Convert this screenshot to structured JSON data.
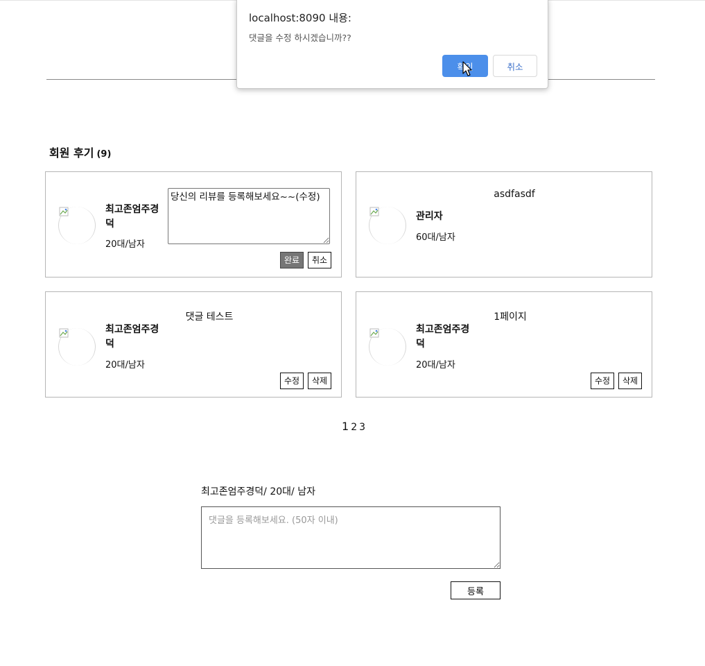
{
  "dialog": {
    "title": "localhost:8090 내용:",
    "message": "댓글을 수정 하시겠습니까??",
    "ok_label": "확인",
    "cancel_label": "취소"
  },
  "reviews": {
    "title": "회원 후기",
    "count": "(9)",
    "cards": [
      {
        "name": "최고존엄주경덕",
        "age_gender": "20대/남자",
        "edit_value": "당신의 리뷰를 등록해보세요~~(수정)",
        "done_label": "완료",
        "cancel_label": "취소"
      },
      {
        "content": "asdfasdf",
        "name": "관리자",
        "age_gender": "60대/남자"
      },
      {
        "content": "댓글 테스트",
        "name": "최고존엄주경덕",
        "age_gender": "20대/남자",
        "edit_label": "수정",
        "delete_label": "삭제"
      },
      {
        "content": "1페이지",
        "name": "최고존엄주경덕",
        "age_gender": "20대/남자",
        "edit_label": "수정",
        "delete_label": "삭제"
      }
    ]
  },
  "pagination": {
    "pages": [
      "1",
      "2",
      "3"
    ],
    "current": "1"
  },
  "comment_form": {
    "writer_info": "최고존엄주경덕/ 20대/ 남자",
    "placeholder": "댓글을 등록해보세요. (50자 이내)",
    "submit_label": "등록"
  }
}
